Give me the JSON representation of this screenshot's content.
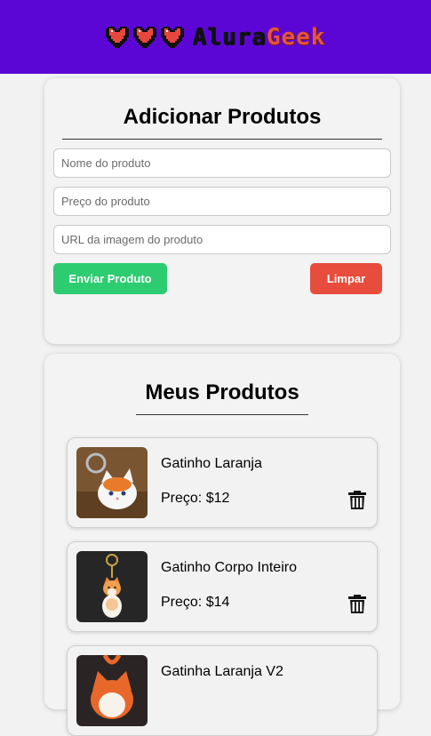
{
  "header": {
    "logo_part1": "Alura",
    "logo_part2": "Geek",
    "heart_icons": [
      "heart-icon",
      "heart-icon",
      "heart-icon"
    ]
  },
  "form": {
    "title": "Adicionar Produtos",
    "name_placeholder": "Nome do produto",
    "price_placeholder": "Preço do produto",
    "image_placeholder": "URL da imagem do produto",
    "send_label": "Enviar Produto",
    "clear_label": "Limpar"
  },
  "list": {
    "title": "Meus Produtos",
    "products": [
      {
        "name": "Gatinho Laranja",
        "price": "Preço: $12"
      },
      {
        "name": "Gatinho Corpo Inteiro",
        "price": "Preço: $14"
      },
      {
        "name": "Gatinha Laranja V2"
      }
    ]
  },
  "colors": {
    "header_bg": "#5c06d6",
    "send_button": "#2ecc71",
    "clear_button": "#e74c3c",
    "logo_accent": "#e4543e"
  }
}
